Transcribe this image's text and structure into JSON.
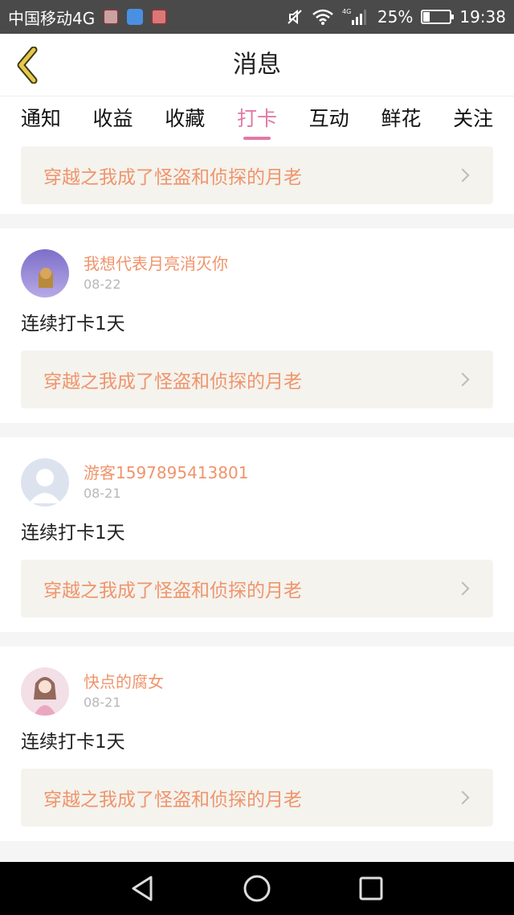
{
  "status_bar": {
    "carrier": "中国移动4G",
    "network": "4G",
    "battery_percent": "25%",
    "battery_level": 0.25,
    "time": "19:38"
  },
  "header": {
    "title": "消息"
  },
  "tabs": [
    {
      "label": "通知",
      "active": false
    },
    {
      "label": "收益",
      "active": false
    },
    {
      "label": "收藏",
      "active": false
    },
    {
      "label": "打卡",
      "active": true
    },
    {
      "label": "互动",
      "active": false
    },
    {
      "label": "鲜花",
      "active": false
    },
    {
      "label": "关注",
      "active": false
    }
  ],
  "partial_card": {
    "book_title": "穿越之我成了怪盗和侦探的月老"
  },
  "items": [
    {
      "user_name": "我想代表月亮消灭你",
      "date": "08-22",
      "checkin_text": "连续打卡1天",
      "book_title": "穿越之我成了怪盗和侦探的月老"
    },
    {
      "user_name": "游客1597895413801",
      "date": "08-21",
      "checkin_text": "连续打卡1天",
      "book_title": "穿越之我成了怪盗和侦探的月老"
    },
    {
      "user_name": "快点的腐女",
      "date": "08-21",
      "checkin_text": "连续打卡1天",
      "book_title": "穿越之我成了怪盗和侦探的月老"
    }
  ],
  "colors": {
    "accent_pink": "#e07aa5",
    "link_orange": "#f0946b",
    "back_arrow_yellow": "#e8c84a"
  }
}
